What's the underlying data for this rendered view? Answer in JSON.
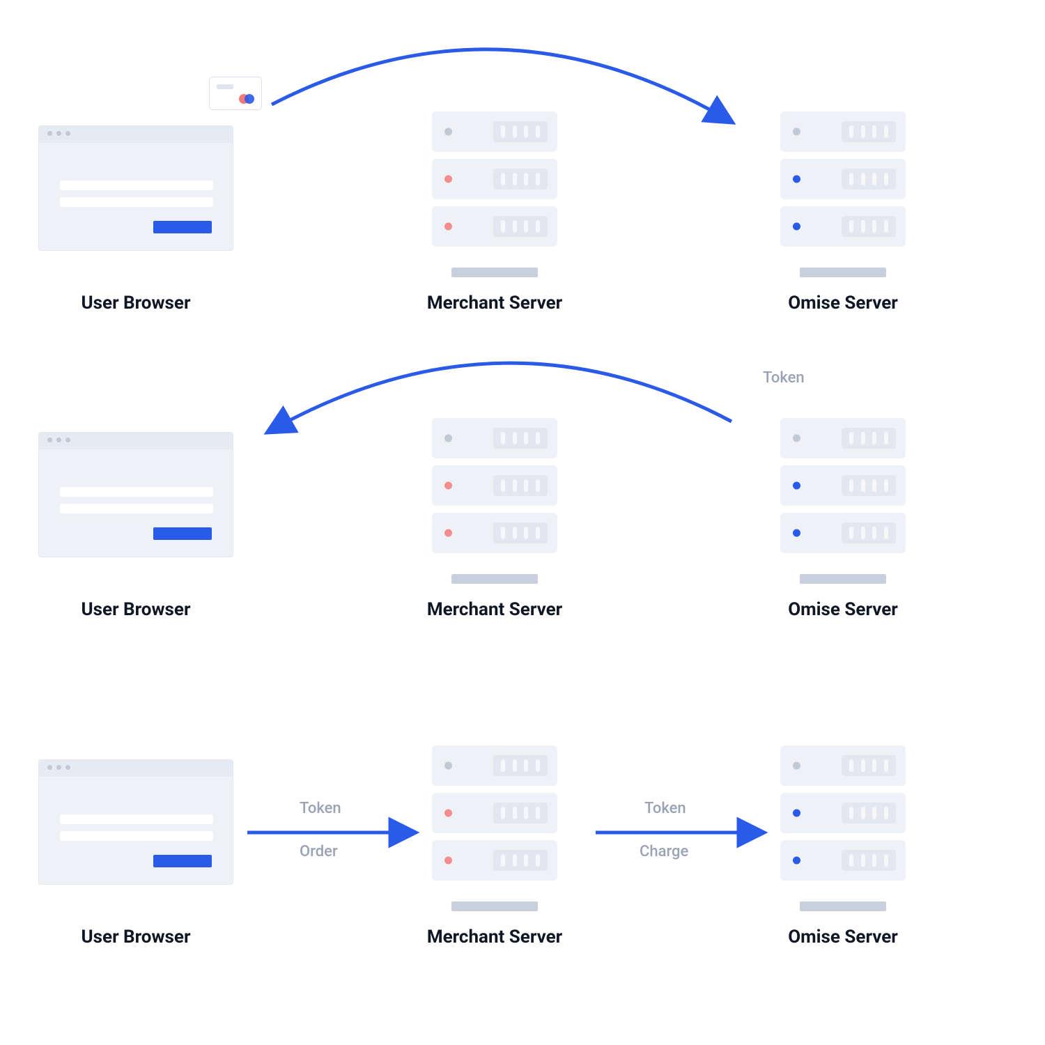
{
  "colors": {
    "arrow": "#2a5ae8",
    "muted_text": "#9aa3b5",
    "heading": "#0f1624"
  },
  "rows": [
    {
      "browser_label": "User Browser",
      "merchant_label": "Merchant Server",
      "omise_label": "Omise Server",
      "arrow": {
        "type": "arc",
        "from": "browser",
        "to": "omise"
      },
      "show_card": true
    },
    {
      "browser_label": "User Browser",
      "merchant_label": "Merchant Server",
      "omise_label": "Omise Server",
      "arrow": {
        "type": "arc",
        "from": "omise",
        "to": "browser",
        "label": "Token"
      }
    },
    {
      "browser_label": "User Browser",
      "merchant_label": "Merchant Server",
      "omise_label": "Omise Server",
      "arrows": [
        {
          "type": "straight",
          "from": "browser",
          "to": "merchant",
          "label_top": "Token",
          "label_bottom": "Order"
        },
        {
          "type": "straight",
          "from": "merchant",
          "to": "omise",
          "label_top": "Token",
          "label_bottom": "Charge"
        }
      ]
    }
  ]
}
